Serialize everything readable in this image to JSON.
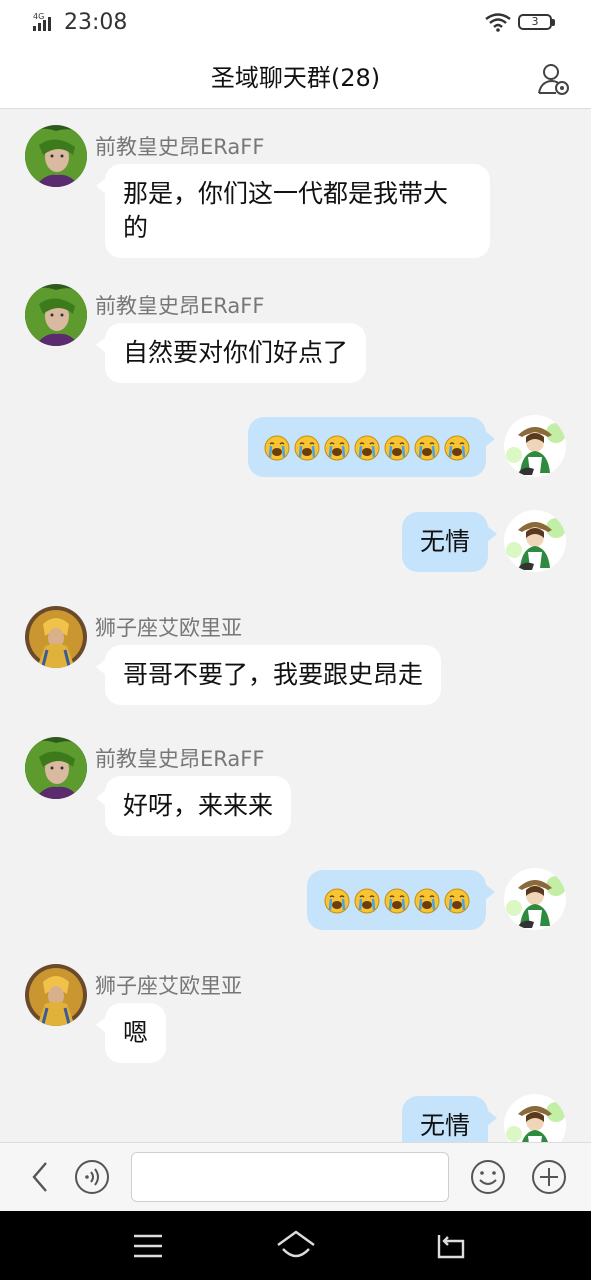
{
  "status_bar": {
    "network": "4G",
    "time": "23:08",
    "battery": "3"
  },
  "header": {
    "title": "圣域聊天群(28)"
  },
  "messages": [
    {
      "side": "in",
      "sender": "前教皇史昂ERaFF",
      "text": "那是，你们这一代都是我带大的",
      "line1": "那是，你们这一代都是我带大",
      "line2": "的"
    },
    {
      "side": "in",
      "sender": "前教皇史昂ERaFF",
      "text": "自然要对你们好点了"
    },
    {
      "side": "out",
      "emoji_count": 7,
      "emoji": "loudly-crying-face"
    },
    {
      "side": "out",
      "text": "无情"
    },
    {
      "side": "in",
      "sender": "狮子座艾欧里亚",
      "text": "哥哥不要了，我要跟史昂走"
    },
    {
      "side": "in",
      "sender": "前教皇史昂ERaFF",
      "text": "好呀，来来来"
    },
    {
      "side": "out",
      "emoji_count": 5,
      "emoji": "loudly-crying-face"
    },
    {
      "side": "in",
      "sender": "狮子座艾欧里亚",
      "text": "嗯"
    },
    {
      "side": "out",
      "text": "无情"
    }
  ],
  "input_bar": {
    "placeholder": "",
    "value": ""
  },
  "colors": {
    "outgoing_bubble": "#c5e3fb",
    "incoming_bubble": "#ffffff",
    "background": "#f2f2f2",
    "nav_bar": "#000000"
  }
}
